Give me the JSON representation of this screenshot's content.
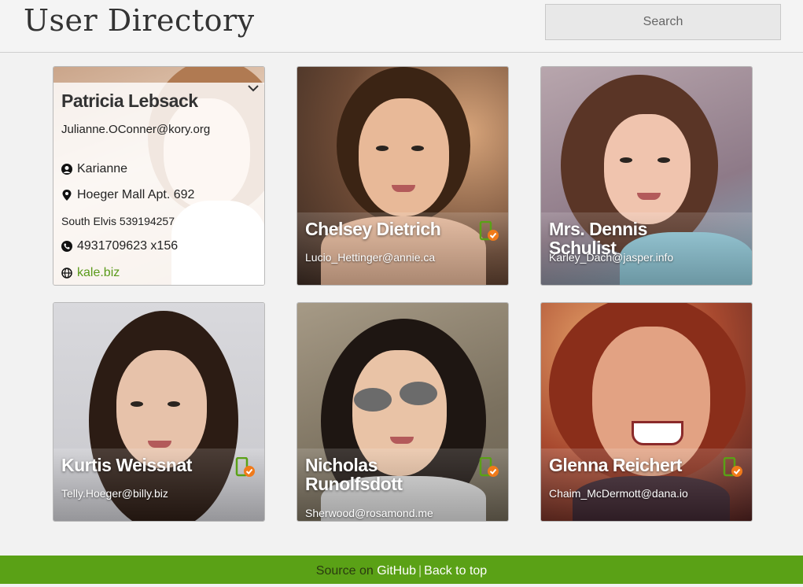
{
  "header": {
    "title": "User Directory",
    "search_placeholder": "Search"
  },
  "expanded_user": {
    "name": "Patricia Lebsack",
    "email": "Julianne.OConner@kory.org",
    "username": "Karianne",
    "street": "Hoeger Mall Apt. 692",
    "city_zip": "South Elvis 539194257",
    "phone": "4931709623 x156",
    "website": "kale.biz"
  },
  "users": [
    {
      "name": "Chelsey Dietrich",
      "email": "Lucio_Hettinger@annie.ca"
    },
    {
      "name": "Mrs. Dennis Schulist",
      "email": "Karley_Dach@jasper.info"
    },
    {
      "name": "Kurtis Weissnat",
      "email": "Telly.Hoeger@billy.biz"
    },
    {
      "name": "Nicholas Runolfsdott",
      "email": "Sherwood@rosamond.me"
    },
    {
      "name": "Glenna Reichert",
      "email": "Chaim_McDermott@dana.io"
    }
  ],
  "icons": {
    "phone_status": "mobile-verified-icon",
    "expand": "chevron-down-icon",
    "user": "user-icon",
    "location": "map-pin-icon",
    "phone": "phone-icon",
    "web": "globe-icon"
  },
  "footer": {
    "prefix": "Source on ",
    "github_link": "GitHub",
    "separator": "|",
    "back_to_top": "Back to top"
  },
  "colors": {
    "accent_green": "#5aa116",
    "badge_orange": "#f07a1a",
    "link_green": "#5a9a1a"
  }
}
